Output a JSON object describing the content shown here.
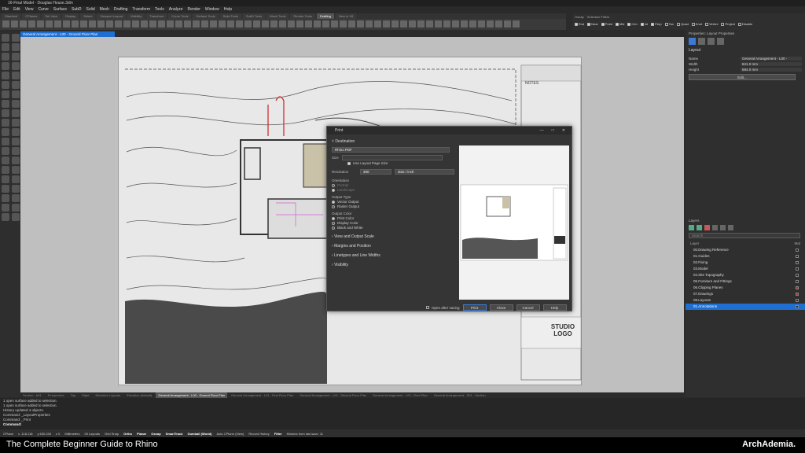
{
  "window": {
    "title": "16-Final Model - Douglas House.3dm"
  },
  "menu": [
    "File",
    "Edit",
    "View",
    "Curve",
    "Surface",
    "SubD",
    "Solid",
    "Mesh",
    "Drafting",
    "Transform",
    "Tools",
    "Analyze",
    "Render",
    "Window",
    "Help"
  ],
  "toolbar_tabs": [
    "Standard",
    "CPlanes",
    "Set View",
    "Display",
    "Select",
    "Viewport Layout",
    "Visibility",
    "Transform",
    "Curve Tools",
    "Surface Tools",
    "Solid Tools",
    "SubD Tools",
    "Mesh Tools",
    "Render Tools",
    "Drafting",
    "New in V8"
  ],
  "toolbar_active_tab": "Drafting",
  "osnap": {
    "tabs": [
      "Osnap",
      "Selection Filters"
    ],
    "items": [
      {
        "label": "End",
        "checked": true
      },
      {
        "label": "Near",
        "checked": true
      },
      {
        "label": "Point",
        "checked": true
      },
      {
        "label": "Mid",
        "checked": true
      },
      {
        "label": "Cen",
        "checked": true
      },
      {
        "label": "Int",
        "checked": true
      },
      {
        "label": "Perp",
        "checked": true
      },
      {
        "label": "Tan",
        "checked": false
      },
      {
        "label": "Quad",
        "checked": false
      },
      {
        "label": "Knot",
        "checked": false
      },
      {
        "label": "Vertex",
        "checked": false
      },
      {
        "label": "Project",
        "checked": false
      },
      {
        "label": "Disable",
        "checked": false
      }
    ]
  },
  "viewport_tab": "General Arrangement - L00 - Ground Floor Plan",
  "sheet": {
    "notes_label": "NOTES",
    "studio_logo": "STUDIO LOGO"
  },
  "print_dialog": {
    "title": "Print",
    "destination": {
      "header": "Destination",
      "printer": "Rhino PDF",
      "size_label": "Size",
      "use_layout_page_size": "Use Layout Page Size",
      "resolution_label": "Resolution",
      "resolution_value": "300",
      "resolution_unit": "dots / inch",
      "orientation_label": "Orientation",
      "orientation_options": [
        "Portrait",
        "Landscape"
      ],
      "output_type_label": "Output Type",
      "output_type_options": [
        "Vector Output",
        "Raster Output"
      ],
      "output_color_label": "Output Color",
      "output_color_options": [
        "Print Color",
        "Display Color",
        "Black and White"
      ]
    },
    "sections": [
      "View and Output Scale",
      "Margins and Position",
      "Linetypes and Line Widths",
      "Visibility"
    ],
    "open_after_saving": "Open after saving",
    "buttons": {
      "print": "Print",
      "close": "Close",
      "cancel": "Cancel",
      "help": "Help"
    }
  },
  "properties": {
    "header": "Properties: Layout Properties",
    "section": "Layout",
    "rows": [
      {
        "k": "Name",
        "v": "General Arrangement - L00 -"
      },
      {
        "k": "Width",
        "v": "841.0 mm"
      },
      {
        "k": "Height",
        "v": "594.0 mm"
      }
    ],
    "edit_button": "Edit..."
  },
  "layers": {
    "header": "Layers",
    "search_placeholder": "Search",
    "column_label": "Layer",
    "column_label_right": "Mat",
    "rows": [
      {
        "name": "00.Drawing Reference",
        "color": "#222222",
        "selected": false
      },
      {
        "name": "01.Guides",
        "color": "#222222",
        "selected": false
      },
      {
        "name": "02.Fixing",
        "color": "#222222",
        "selected": false
      },
      {
        "name": "03.Model",
        "color": "#222222",
        "selected": false
      },
      {
        "name": "04.Site Topography",
        "color": "#222222",
        "selected": false
      },
      {
        "name": "05.Furniture and Fittings",
        "color": "#222222",
        "selected": false
      },
      {
        "name": "06.Clipping Planes",
        "color": "#cc2222",
        "selected": false
      },
      {
        "name": "07.Drawings",
        "color": "#cc2222",
        "selected": false
      },
      {
        "name": "08.Layouts",
        "color": "#222222",
        "selected": false
      },
      {
        "name": "01.Annotations",
        "color": "#222222",
        "selected": true
      }
    ]
  },
  "bottom_tabs": [
    "Section - A01",
    "Perspective",
    "Top",
    "Right",
    "Elevation Layouts",
    "Elevation (default)",
    "General Arrangement - L00 - Ground Floor Plan",
    "General Arrangement - L01 - First Floor Plan",
    "General Arrangement - L02 - Second Floor Plan",
    "General Arrangement - L03 - Roof Plan",
    "General Arrangement - S01 - Section"
  ],
  "bottom_tab_active": "General Arrangement - L00 - Ground Floor Plan",
  "command_history": [
    "1 open surface added to selection.",
    "1 open surface added to selection.",
    "History updated 4 objects.",
    "Command: _LayoutProperties",
    "Command: _Print"
  ],
  "command_prompt": "Command:",
  "status_bar": {
    "cplane": "CPlane",
    "x": "x -118.118",
    "y": "y 630.245",
    "z": "z 0",
    "units": "Millimeters",
    "layer": "00 Layouts",
    "items": [
      "Grid Snap",
      "Ortho",
      "Planar",
      "Osnap",
      "SmartTrack",
      "Gumball (World)",
      "Auto CPlane (View)",
      "Record History",
      "Filter",
      "Minutes from last save: 11"
    ]
  },
  "banner": {
    "title": "The Complete Beginner Guide to Rhino",
    "logo": "ArchAdemia."
  }
}
